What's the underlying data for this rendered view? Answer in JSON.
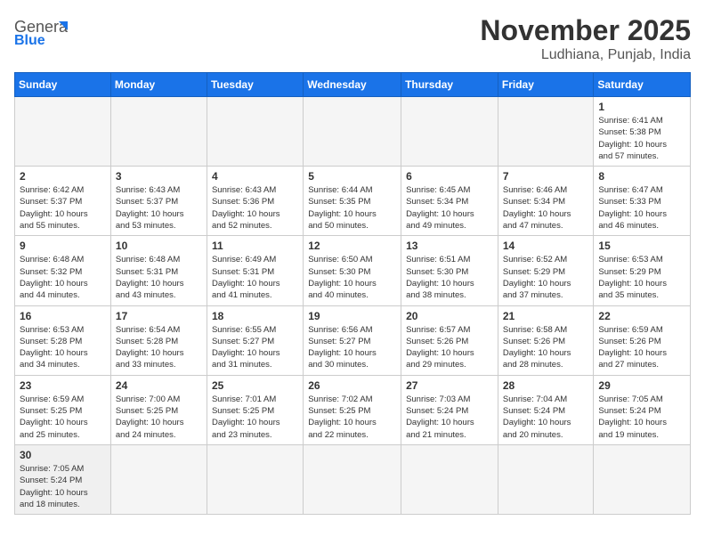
{
  "header": {
    "logo_general": "General",
    "logo_blue": "Blue",
    "month_title": "November 2025",
    "location": "Ludhiana, Punjab, India"
  },
  "days_of_week": [
    "Sunday",
    "Monday",
    "Tuesday",
    "Wednesday",
    "Thursday",
    "Friday",
    "Saturday"
  ],
  "weeks": [
    [
      {
        "day": "",
        "info": ""
      },
      {
        "day": "",
        "info": ""
      },
      {
        "day": "",
        "info": ""
      },
      {
        "day": "",
        "info": ""
      },
      {
        "day": "",
        "info": ""
      },
      {
        "day": "",
        "info": ""
      },
      {
        "day": "1",
        "info": "Sunrise: 6:41 AM\nSunset: 5:38 PM\nDaylight: 10 hours\nand 57 minutes."
      }
    ],
    [
      {
        "day": "2",
        "info": "Sunrise: 6:42 AM\nSunset: 5:37 PM\nDaylight: 10 hours\nand 55 minutes."
      },
      {
        "day": "3",
        "info": "Sunrise: 6:43 AM\nSunset: 5:37 PM\nDaylight: 10 hours\nand 53 minutes."
      },
      {
        "day": "4",
        "info": "Sunrise: 6:43 AM\nSunset: 5:36 PM\nDaylight: 10 hours\nand 52 minutes."
      },
      {
        "day": "5",
        "info": "Sunrise: 6:44 AM\nSunset: 5:35 PM\nDaylight: 10 hours\nand 50 minutes."
      },
      {
        "day": "6",
        "info": "Sunrise: 6:45 AM\nSunset: 5:34 PM\nDaylight: 10 hours\nand 49 minutes."
      },
      {
        "day": "7",
        "info": "Sunrise: 6:46 AM\nSunset: 5:34 PM\nDaylight: 10 hours\nand 47 minutes."
      },
      {
        "day": "8",
        "info": "Sunrise: 6:47 AM\nSunset: 5:33 PM\nDaylight: 10 hours\nand 46 minutes."
      }
    ],
    [
      {
        "day": "9",
        "info": "Sunrise: 6:48 AM\nSunset: 5:32 PM\nDaylight: 10 hours\nand 44 minutes."
      },
      {
        "day": "10",
        "info": "Sunrise: 6:48 AM\nSunset: 5:31 PM\nDaylight: 10 hours\nand 43 minutes."
      },
      {
        "day": "11",
        "info": "Sunrise: 6:49 AM\nSunset: 5:31 PM\nDaylight: 10 hours\nand 41 minutes."
      },
      {
        "day": "12",
        "info": "Sunrise: 6:50 AM\nSunset: 5:30 PM\nDaylight: 10 hours\nand 40 minutes."
      },
      {
        "day": "13",
        "info": "Sunrise: 6:51 AM\nSunset: 5:30 PM\nDaylight: 10 hours\nand 38 minutes."
      },
      {
        "day": "14",
        "info": "Sunrise: 6:52 AM\nSunset: 5:29 PM\nDaylight: 10 hours\nand 37 minutes."
      },
      {
        "day": "15",
        "info": "Sunrise: 6:53 AM\nSunset: 5:29 PM\nDaylight: 10 hours\nand 35 minutes."
      }
    ],
    [
      {
        "day": "16",
        "info": "Sunrise: 6:53 AM\nSunset: 5:28 PM\nDaylight: 10 hours\nand 34 minutes."
      },
      {
        "day": "17",
        "info": "Sunrise: 6:54 AM\nSunset: 5:28 PM\nDaylight: 10 hours\nand 33 minutes."
      },
      {
        "day": "18",
        "info": "Sunrise: 6:55 AM\nSunset: 5:27 PM\nDaylight: 10 hours\nand 31 minutes."
      },
      {
        "day": "19",
        "info": "Sunrise: 6:56 AM\nSunset: 5:27 PM\nDaylight: 10 hours\nand 30 minutes."
      },
      {
        "day": "20",
        "info": "Sunrise: 6:57 AM\nSunset: 5:26 PM\nDaylight: 10 hours\nand 29 minutes."
      },
      {
        "day": "21",
        "info": "Sunrise: 6:58 AM\nSunset: 5:26 PM\nDaylight: 10 hours\nand 28 minutes."
      },
      {
        "day": "22",
        "info": "Sunrise: 6:59 AM\nSunset: 5:26 PM\nDaylight: 10 hours\nand 27 minutes."
      }
    ],
    [
      {
        "day": "23",
        "info": "Sunrise: 6:59 AM\nSunset: 5:25 PM\nDaylight: 10 hours\nand 25 minutes."
      },
      {
        "day": "24",
        "info": "Sunrise: 7:00 AM\nSunset: 5:25 PM\nDaylight: 10 hours\nand 24 minutes."
      },
      {
        "day": "25",
        "info": "Sunrise: 7:01 AM\nSunset: 5:25 PM\nDaylight: 10 hours\nand 23 minutes."
      },
      {
        "day": "26",
        "info": "Sunrise: 7:02 AM\nSunset: 5:25 PM\nDaylight: 10 hours\nand 22 minutes."
      },
      {
        "day": "27",
        "info": "Sunrise: 7:03 AM\nSunset: 5:24 PM\nDaylight: 10 hours\nand 21 minutes."
      },
      {
        "day": "28",
        "info": "Sunrise: 7:04 AM\nSunset: 5:24 PM\nDaylight: 10 hours\nand 20 minutes."
      },
      {
        "day": "29",
        "info": "Sunrise: 7:05 AM\nSunset: 5:24 PM\nDaylight: 10 hours\nand 19 minutes."
      }
    ],
    [
      {
        "day": "30",
        "info": "Sunrise: 7:05 AM\nSunset: 5:24 PM\nDaylight: 10 hours\nand 18 minutes."
      },
      {
        "day": "",
        "info": ""
      },
      {
        "day": "",
        "info": ""
      },
      {
        "day": "",
        "info": ""
      },
      {
        "day": "",
        "info": ""
      },
      {
        "day": "",
        "info": ""
      },
      {
        "day": "",
        "info": ""
      }
    ]
  ]
}
